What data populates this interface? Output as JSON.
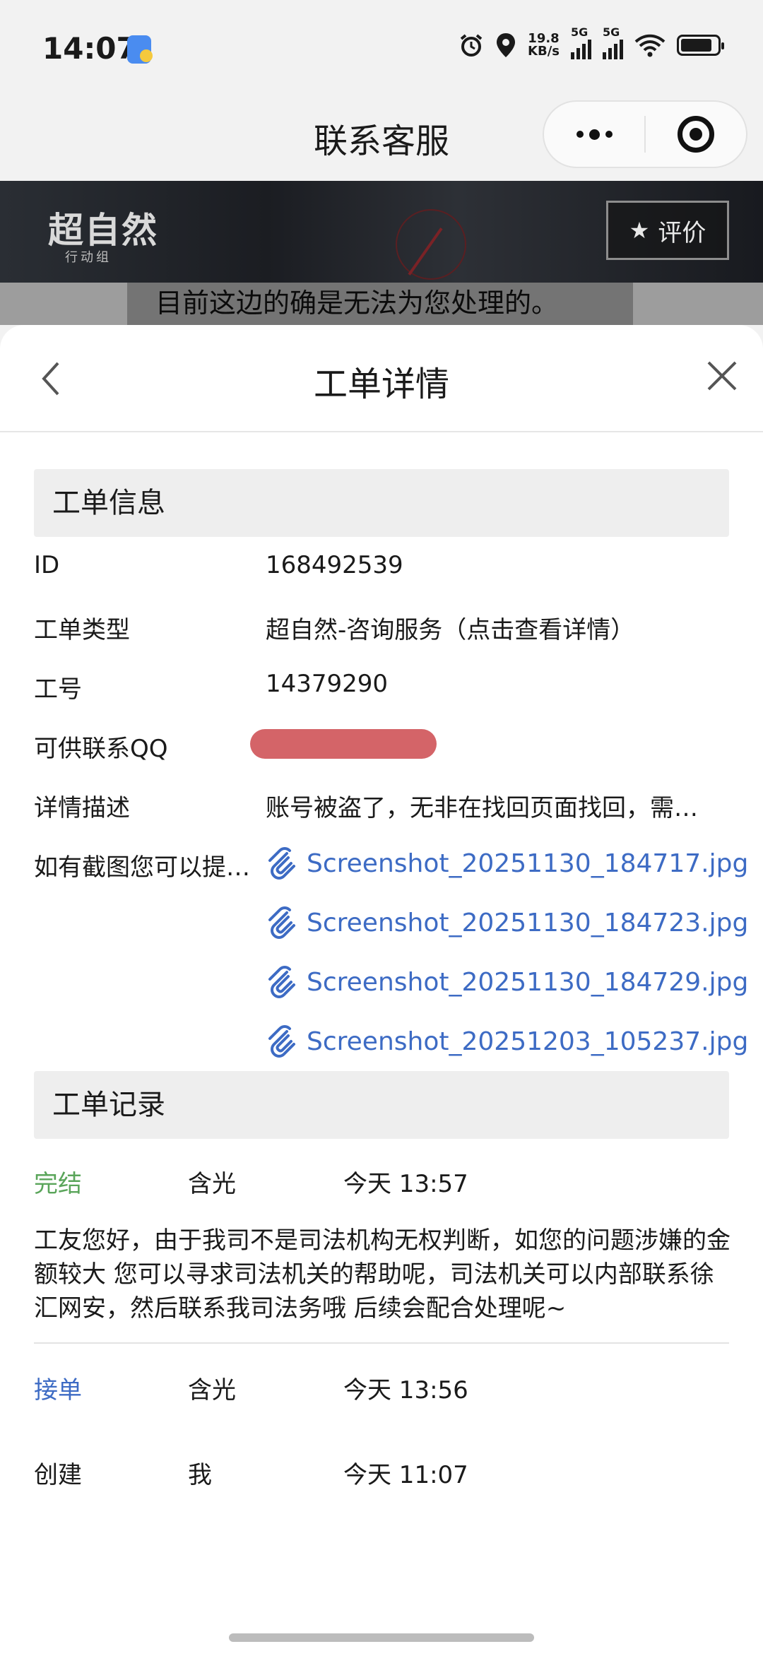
{
  "status_bar": {
    "time": "14:07",
    "net_speed_value": "19.8",
    "net_speed_unit": "KB/s",
    "sim1_label": "5G",
    "sim2_label": "5G"
  },
  "mini_program": {
    "title": "联系客服"
  },
  "banner": {
    "game_logo": "超自然",
    "game_logo_sub": "行动组",
    "rate_label": "评价"
  },
  "background_chat": {
    "text": "目前这边的确是无法为您处理的。"
  },
  "sheet": {
    "title": "工单详情",
    "info_section_title": "工单信息",
    "fields": [
      {
        "label": "ID",
        "value": "168492539"
      },
      {
        "label": "工单类型",
        "value": "超自然-咨询服务（点击查看详情）"
      },
      {
        "label": "工号",
        "value": "14379290"
      },
      {
        "label": "可供联系QQ",
        "value": ""
      },
      {
        "label": "详情描述",
        "value": "账号被盗了，无非在找回页面找回，需…"
      },
      {
        "label": "如有截图您可以提…",
        "value": ""
      }
    ],
    "attachments": [
      "Screenshot_20251130_184717.jpg",
      "Screenshot_20251130_184723.jpg",
      "Screenshot_20251130_184729.jpg",
      "Screenshot_20251203_105237.jpg"
    ],
    "records_section_title": "工单记录",
    "records": [
      {
        "status": "完结",
        "who": "含光",
        "time": "今天 13:57",
        "status_color": "#5aa55a"
      },
      {
        "status": "接单",
        "who": "含光",
        "time": "今天 13:56",
        "status_color": "#3d6bc4"
      },
      {
        "status": "创建",
        "who": "我",
        "time": "今天 11:07",
        "status_color": "#1a1a1a"
      }
    ],
    "record_message": "工友您好，由于我司不是司法机构无权判断，如您的问题涉嫌的金额较大 您可以寻求司法机关的帮助呢，司法机关可以内部联系徐汇网安，然后联系我司法务哦 后续会配合处理呢~"
  }
}
